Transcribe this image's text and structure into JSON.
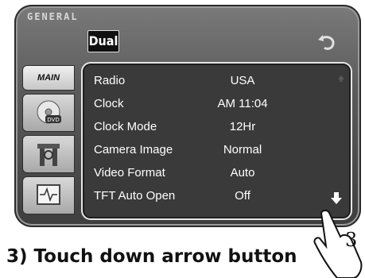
{
  "header": {
    "section_label": "GENERAL",
    "brand_logo": "Dual"
  },
  "sidebar": {
    "tabs": [
      {
        "label": "MAIN",
        "icon": "main-tab"
      },
      {
        "label": "",
        "icon": "disc-dvd-icon"
      },
      {
        "label": "",
        "icon": "tools-icon"
      },
      {
        "label": "",
        "icon": "screen-waveform-icon"
      }
    ]
  },
  "settings": {
    "rows": [
      {
        "name": "Radio",
        "value": "USA"
      },
      {
        "name": "Clock",
        "value": "AM 11:04"
      },
      {
        "name": "Clock Mode",
        "value": "12Hr"
      },
      {
        "name": "Camera Image",
        "value": "Normal"
      },
      {
        "name": "Video Format",
        "value": "Auto"
      },
      {
        "name": "TFT Auto Open",
        "value": "Off"
      }
    ]
  },
  "caption": {
    "text": "3) Touch down arrow button",
    "step_number": "3"
  },
  "colors": {
    "panel_bg": "#5a5a5a",
    "list_bg": "#3a3a3a",
    "text": "#ffffff"
  }
}
